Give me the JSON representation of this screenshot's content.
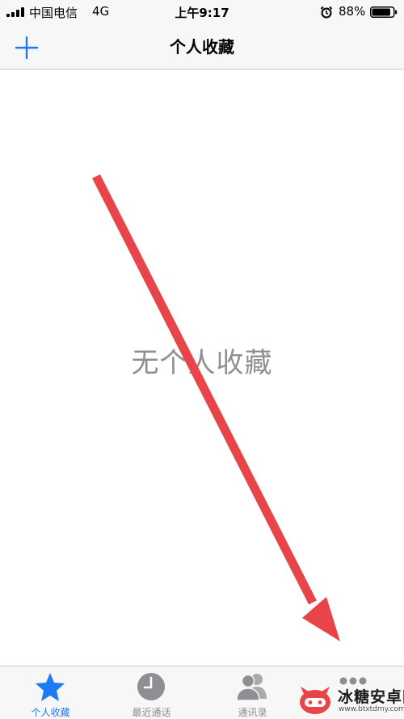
{
  "status_bar": {
    "carrier": "中国电信",
    "network": "4G",
    "time": "上午9:17",
    "battery": "88%",
    "battery_level": 0.88
  },
  "nav": {
    "title": "个人收藏",
    "add_icon": "plus-icon"
  },
  "content": {
    "empty_message": "无个人收藏"
  },
  "annotation": {
    "type": "red-arrow",
    "color": "#e8454a"
  },
  "tabs": [
    {
      "label": "个人收藏",
      "icon": "star-icon",
      "active": true
    },
    {
      "label": "最近通话",
      "icon": "clock-icon",
      "active": false
    },
    {
      "label": "通讯录",
      "icon": "contacts-icon",
      "active": false
    },
    {
      "label": "",
      "icon": "keypad-icon",
      "active": false
    }
  ],
  "watermark": {
    "name": "冰糖安卓网",
    "url": "www.btxtdmy.com"
  },
  "colors": {
    "accent": "#1d7bf5",
    "inactive": "#8e8e93",
    "bar_background": "#f7f7f7",
    "arrow": "#e8454a"
  }
}
